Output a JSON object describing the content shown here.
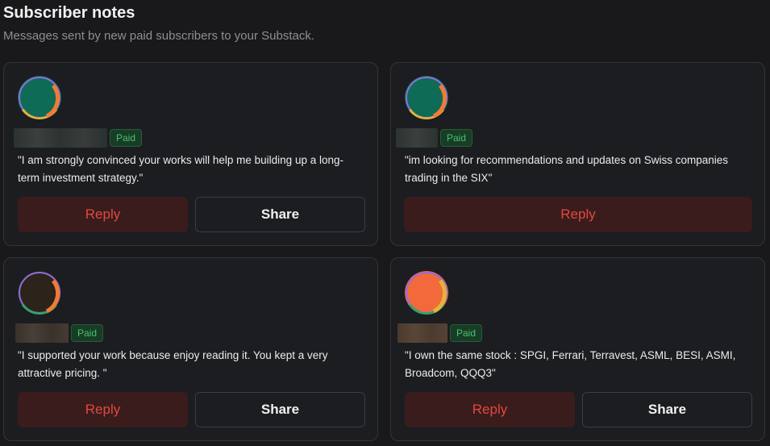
{
  "header": {
    "title": "Subscriber notes",
    "subtitle": "Messages sent by new paid subscribers to your Substack."
  },
  "notes": [
    {
      "badge": "Paid",
      "message": "\"I am strongly convinced your works will help me building up a long-term investment strategy.\"",
      "reply_label": "Reply",
      "share_label": "Share",
      "avatar_colors": {
        "main": "#0e6b55",
        "ring1": "#f27a36",
        "ring2": "#e3b33b",
        "ring3": "#8f6de0"
      }
    },
    {
      "badge": "Paid",
      "message": "\"im looking for recommendations and updates on Swiss companies trading in the SIX\"",
      "reply_label": "Reply",
      "avatar_colors": {
        "main": "#0e6b55",
        "ring1": "#f27a36",
        "ring2": "#e3b33b",
        "ring3": "#8f6de0"
      }
    },
    {
      "badge": "Paid",
      "message": "\"I supported your work because enjoy reading it. You kept a very attractive pricing. \"",
      "reply_label": "Reply",
      "share_label": "Share",
      "avatar_colors": {
        "main": "#2c231b",
        "ring1": "#f27a36",
        "ring2": "#2ea36a",
        "ring3": "#8f6de0"
      }
    },
    {
      "badge": "Paid",
      "message": "\"I own the same stock : SPGI, Ferrari, Terravest, ASML, BESI, ASMI, Broadcom, QQQ3\"",
      "reply_label": "Reply",
      "share_label": "Share",
      "avatar_colors": {
        "main": "#f26a3c",
        "ring1": "#e3b33b",
        "ring2": "#2ea36a",
        "ring3": "#8f6de0"
      }
    }
  ],
  "colors": {
    "background": "#19191b",
    "card": "#1c1d20",
    "reply_text": "#e2493f",
    "reply_bg": "#3a1c1c",
    "badge_text": "#4cc06f",
    "badge_bg": "#173d26"
  }
}
